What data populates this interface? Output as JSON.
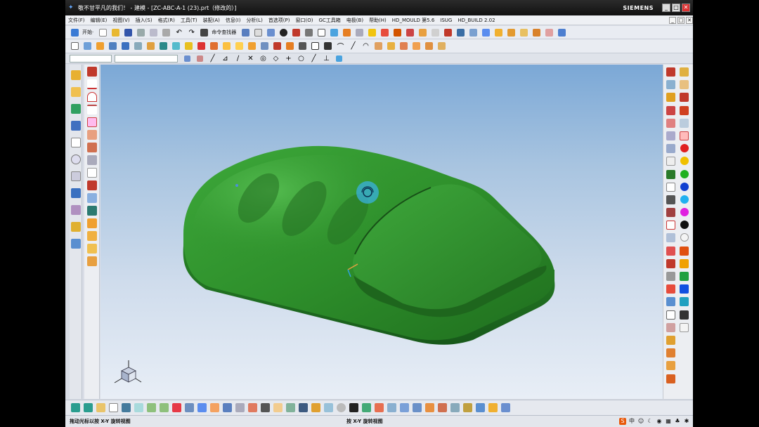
{
  "window": {
    "title": "敬不甘平凡的我们！ - 建模 - [ZC-ABC-A-1 (23).prt（修改的）]",
    "brand": "SIEMENS",
    "controls": {
      "minimize": "_",
      "maximize": "□",
      "close": "✕"
    }
  },
  "menubar": {
    "items": [
      "文件(F)",
      "编辑(E)",
      "视图(V)",
      "插入(S)",
      "格式(R)",
      "工具(T)",
      "装配(A)",
      "信息(I)",
      "分析(L)",
      "首选项(P)",
      "窗口(O)",
      "GC工具箱",
      "电极(B)",
      "帮助(H)",
      "HD_MOULD 第5.6",
      "ISUG",
      "HD_BUILD 2.02"
    ],
    "doc_controls": {
      "minimize": "_",
      "restore": "□",
      "close": "✕"
    }
  },
  "toolbar1": {
    "start_label": "开始·",
    "command_finder_label": "命令查找器"
  },
  "statusbar": {
    "left_text": "拖动光标以按 X-Y 旋转视图",
    "center_text": "按 X-Y 旋转视图"
  },
  "tray": {
    "ime": "S",
    "lang": "中"
  },
  "colors": {
    "model_green": "#2f8f2a",
    "title_bg": "#111111",
    "viewport_top": "#7ba8d6",
    "viewport_bottom": "#e8eef6",
    "palette": [
      "#e02020",
      "#f0c000",
      "#20b020",
      "#1040d0",
      "#20b0f0",
      "#e020e0",
      "#101010",
      "#f4f4f4",
      "#e05010",
      "#f0a000",
      "#20a040",
      "#1050e0",
      "#20a0c0"
    ]
  },
  "icons": {
    "rotate_cursor": "rotate-cursor-icon",
    "wcs_triad": "wcs-triad-icon"
  }
}
